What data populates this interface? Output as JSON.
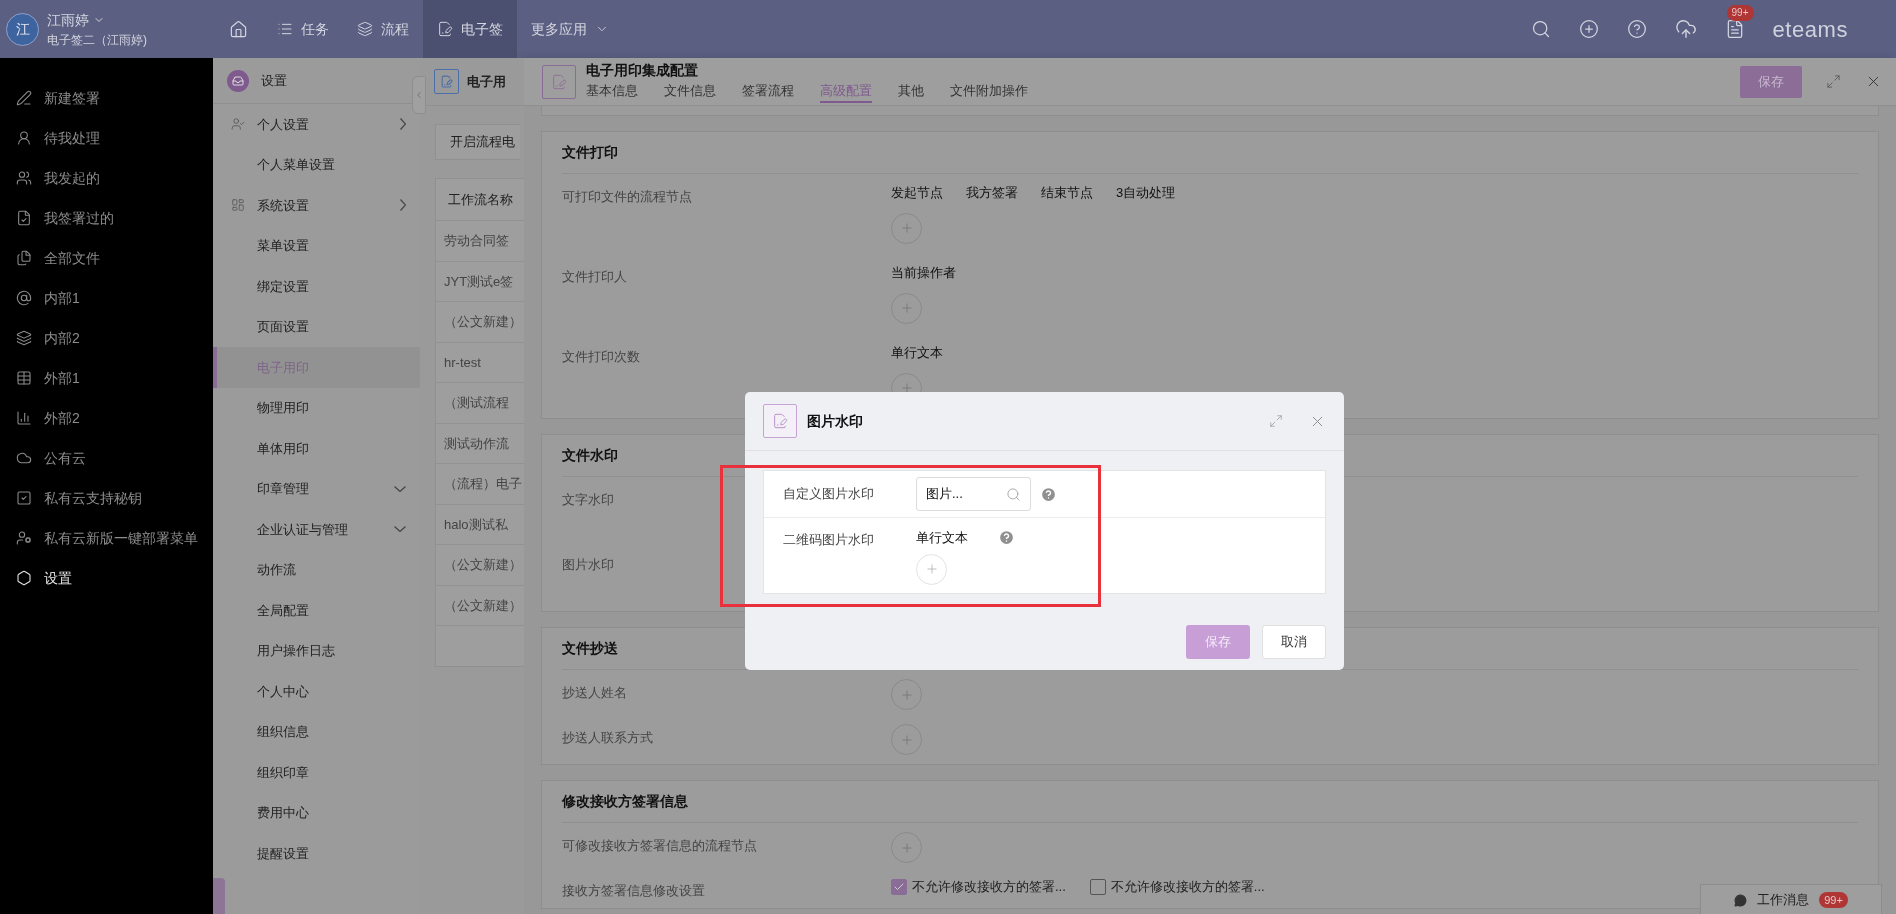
{
  "top_bar": {
    "avatar": "江",
    "user_name": "江雨婷",
    "user_subtitle": "电子签二（江雨婷)",
    "nav": [
      {
        "label": "任务",
        "kind": "link",
        "selected": false
      },
      {
        "label": "流程",
        "kind": "link",
        "selected": false
      },
      {
        "label": "电子签",
        "kind": "link",
        "selected": true
      },
      {
        "label": "更多应用",
        "kind": "menu",
        "selected": false
      }
    ],
    "notification_badge": "99+",
    "brand": "eteams"
  },
  "sidebar": {
    "items": [
      {
        "label": "新建签署",
        "selected": false
      },
      {
        "label": "待我处理",
        "selected": false
      },
      {
        "label": "我发起的",
        "selected": false
      },
      {
        "label": "我签署过的",
        "selected": false
      },
      {
        "label": "全部文件",
        "selected": false
      },
      {
        "label": "内部1",
        "selected": false
      },
      {
        "label": "内部2",
        "selected": false
      },
      {
        "label": "外部1",
        "selected": false
      },
      {
        "label": "外部2",
        "selected": false
      },
      {
        "label": "公有云",
        "selected": false
      },
      {
        "label": "私有云支持秘钥",
        "selected": false
      },
      {
        "label": "私有云新版一键部署菜单",
        "selected": false
      },
      {
        "label": "设置",
        "selected": true
      }
    ]
  },
  "settings_menu": {
    "title": "设置",
    "items": [
      {
        "label": "个人设置",
        "kind": "group",
        "expanded": false,
        "selected": false
      },
      {
        "label": "个人菜单设置",
        "kind": "item",
        "selected": false
      },
      {
        "label": "系统设置",
        "kind": "group",
        "expanded": false,
        "selected": false
      },
      {
        "label": "菜单设置",
        "kind": "item",
        "selected": false
      },
      {
        "label": "绑定设置",
        "kind": "item",
        "selected": false
      },
      {
        "label": "页面设置",
        "kind": "item",
        "selected": false
      },
      {
        "label": "电子用印",
        "kind": "item",
        "selected": true
      },
      {
        "label": "物理用印",
        "kind": "item",
        "selected": false
      },
      {
        "label": "单体用印",
        "kind": "item",
        "selected": false
      },
      {
        "label": "印章管理",
        "kind": "item",
        "expanded": true,
        "selected": false
      },
      {
        "label": "企业认证与管理",
        "kind": "item",
        "expanded": true,
        "selected": false
      },
      {
        "label": "动作流",
        "kind": "item",
        "selected": false
      },
      {
        "label": "全局配置",
        "kind": "item",
        "selected": false
      },
      {
        "label": "用户操作日志",
        "kind": "item",
        "selected": false
      },
      {
        "label": "个人中心",
        "kind": "item",
        "selected": false
      },
      {
        "label": "组织信息",
        "kind": "item",
        "selected": false
      },
      {
        "label": "组织印章",
        "kind": "item",
        "selected": false
      },
      {
        "label": "费用中心",
        "kind": "item",
        "selected": false
      },
      {
        "label": "提醒设置",
        "kind": "item",
        "selected": false
      }
    ]
  },
  "list_panel": {
    "title": "电子用",
    "button": "开启流程电",
    "column": "工作流名称",
    "rows": [
      "劳动合同签",
      "JYT测试e签",
      "（公文新建）",
      "hr-test",
      "（测试流程",
      "测试动作流",
      "（流程）电子",
      "halo测试私",
      "（公文新建）",
      "（公文新建）"
    ]
  },
  "drawer": {
    "title": "电子用印集成配置",
    "tabs": [
      {
        "label": "基本信息",
        "selected": false
      },
      {
        "label": "文件信息",
        "selected": false
      },
      {
        "label": "签署流程",
        "selected": false
      },
      {
        "label": "高级配置",
        "selected": true
      },
      {
        "label": "其他",
        "selected": false
      },
      {
        "label": "文件附加操作",
        "selected": false
      }
    ],
    "save": "保存",
    "sections": [
      {
        "title": "文件打印",
        "rows": [
          {
            "label": "可打印文件的流程节点",
            "kind": "tags",
            "values": [
              "发起节点",
              "我方签署",
              "结束节点",
              "3自动处理"
            ],
            "add": true
          },
          {
            "label": "文件打印人",
            "kind": "tags",
            "values": [
              "当前操作者"
            ],
            "add": true
          },
          {
            "label": "文件打印次数",
            "kind": "tags",
            "values": [
              "单行文本"
            ],
            "add": true
          }
        ]
      },
      {
        "title": "文件水印",
        "rows": [
          {
            "label": "文字水印",
            "kind": "hidden"
          },
          {
            "label": "图片水印",
            "kind": "hidden"
          }
        ]
      },
      {
        "title": "文件抄送",
        "rows": [
          {
            "label": "抄送人姓名",
            "kind": "tags",
            "add": true
          },
          {
            "label": "抄送人联系方式",
            "kind": "tags",
            "add": true
          }
        ]
      },
      {
        "title": "修改接收方签署信息",
        "rows": [
          {
            "label": "可修改接收方签署信息的流程节点",
            "kind": "tags",
            "add": true
          },
          {
            "label": "接收方签署信息修改设置",
            "kind": "checkboxes",
            "options": [
              {
                "label": "不允许修改接收方的签署...",
                "checked": true
              },
              {
                "label": "不允许修改接收方的签署...",
                "checked": false
              }
            ]
          }
        ]
      }
    ]
  },
  "dialog": {
    "title": "图片水印",
    "rows": [
      {
        "label": "自定义图片水印",
        "kind": "search",
        "value": "图片..."
      },
      {
        "label": "二维码图片水印",
        "kind": "text",
        "value": "单行文本",
        "add": true
      }
    ],
    "buttons": [
      {
        "label": "保存",
        "kind": "primary"
      },
      {
        "label": "取消",
        "kind": "default"
      }
    ]
  },
  "work_messages": {
    "label": "工作消息",
    "badge": "99+"
  }
}
